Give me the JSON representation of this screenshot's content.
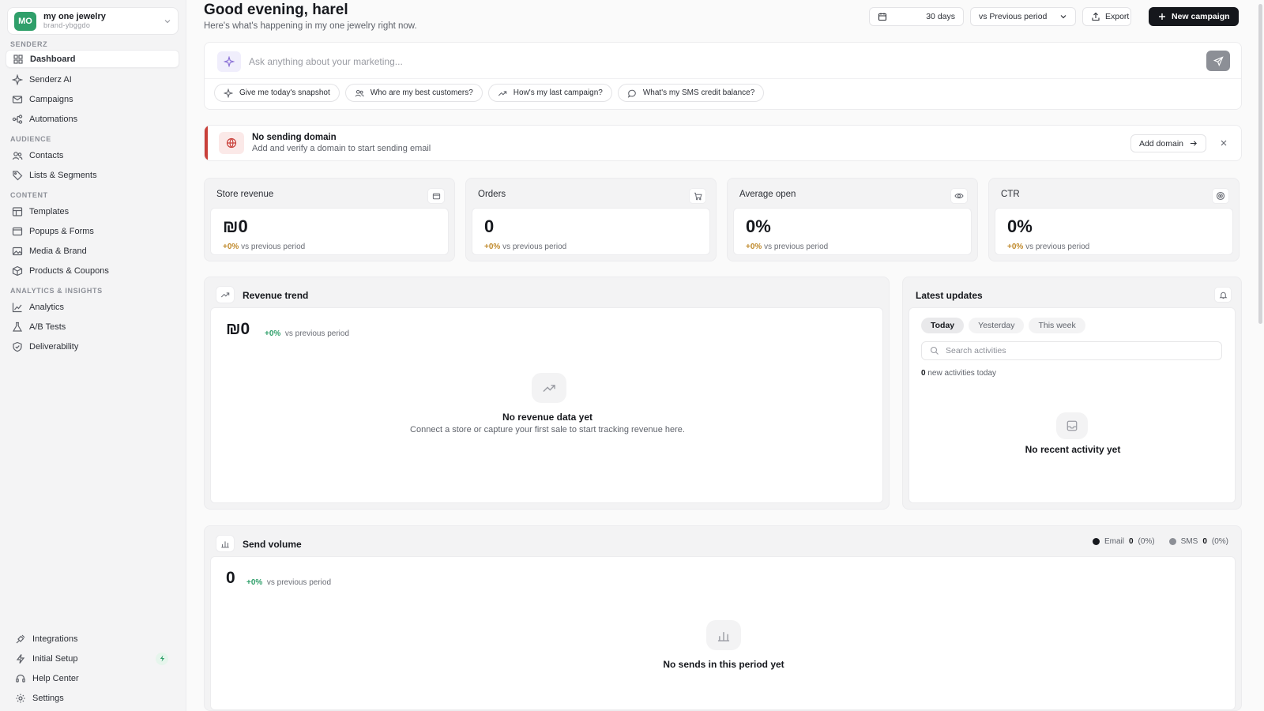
{
  "workspace": {
    "avatar": "MO",
    "name": "my one jewelry",
    "slug": "brand-ybggdo"
  },
  "sidebar": {
    "sections": [
      "SENDERZ",
      "AUDIENCE",
      "CONTENT",
      "ANALYTICS & INSIGHTS"
    ],
    "items": [
      {
        "label": "Dashboard",
        "icon": "grid-icon"
      },
      {
        "label": "Senderz AI",
        "icon": "sparkle-icon"
      },
      {
        "label": "Campaigns",
        "icon": "mail-icon"
      },
      {
        "label": "Automations",
        "icon": "flow-icon"
      },
      {
        "label": "Contacts",
        "icon": "users-icon"
      },
      {
        "label": "Lists & Segments",
        "icon": "tag-icon"
      },
      {
        "label": "Templates",
        "icon": "layout-icon"
      },
      {
        "label": "Popups & Forms",
        "icon": "window-icon"
      },
      {
        "label": "Media & Brand",
        "icon": "image-icon"
      },
      {
        "label": "Products & Coupons",
        "icon": "box-icon"
      },
      {
        "label": "Analytics",
        "icon": "chart-line-icon"
      },
      {
        "label": "A/B Tests",
        "icon": "flask-icon"
      },
      {
        "label": "Deliverability",
        "icon": "shield-icon"
      }
    ],
    "bottom": [
      {
        "label": "Integrations",
        "icon": "plug-icon"
      },
      {
        "label": "Initial Setup",
        "icon": "bolt-icon"
      },
      {
        "label": "Help Center",
        "icon": "headset-icon"
      },
      {
        "label": "Settings",
        "icon": "gear-icon"
      }
    ]
  },
  "header": {
    "greeting": "Good evening, harel",
    "subtitle": "Here's what's happening in my one jewelry right now.",
    "range": "30 days",
    "compare": "vs Previous period",
    "export": "Export",
    "new_campaign": "New campaign"
  },
  "ask": {
    "placeholder": "Ask anything about your marketing...",
    "chips": [
      "Give me today's snapshot",
      "Who are my best customers?",
      "How's my last campaign?",
      "What's my SMS credit balance?"
    ]
  },
  "alert": {
    "title": "No sending domain",
    "subtitle": "Add and verify a domain to start sending email",
    "button": "Add domain",
    "accent": "#c9403a"
  },
  "stats": [
    {
      "title": "Store revenue",
      "value": "₪0",
      "delta": "+0%",
      "delta_text": "vs previous period",
      "icon": "wallet-icon"
    },
    {
      "title": "Orders",
      "value": "0",
      "delta": "+0%",
      "delta_text": "vs previous period",
      "icon": "cart-icon"
    },
    {
      "title": "Average open",
      "value": "0%",
      "delta": "+0%",
      "delta_text": "vs previous period",
      "icon": "eye-icon"
    },
    {
      "title": "CTR",
      "value": "0%",
      "delta": "+0%",
      "delta_text": "vs previous period",
      "icon": "target-icon"
    }
  ],
  "revenue": {
    "title": "Revenue trend",
    "value": "₪0",
    "delta": "+0%",
    "delta_text": "vs previous period",
    "empty_title": "No revenue data yet",
    "empty_sub": "Connect a store or capture your first sale to start tracking revenue here."
  },
  "updates": {
    "title": "Latest updates",
    "tabs": [
      "Today",
      "Yesterday",
      "This week"
    ],
    "search_placeholder": "Search activities",
    "count": "0",
    "count_text": "new activities today",
    "empty_title": "No recent activity yet"
  },
  "volume": {
    "title": "Send volume",
    "value": "0",
    "delta": "+0%",
    "delta_text": "vs previous period",
    "legend": [
      {
        "name": "Email",
        "value": "0",
        "pct": "(0%)",
        "color": "#16181d"
      },
      {
        "name": "SMS",
        "value": "0",
        "pct": "(0%)",
        "color": "#8c8f96"
      }
    ],
    "empty_title": "No sends in this period yet"
  },
  "colors": {
    "brand": "#2f9f6a",
    "dark": "#15171c",
    "positive_delta": "#c08a2c",
    "positive_green": "#2f9f6a"
  }
}
